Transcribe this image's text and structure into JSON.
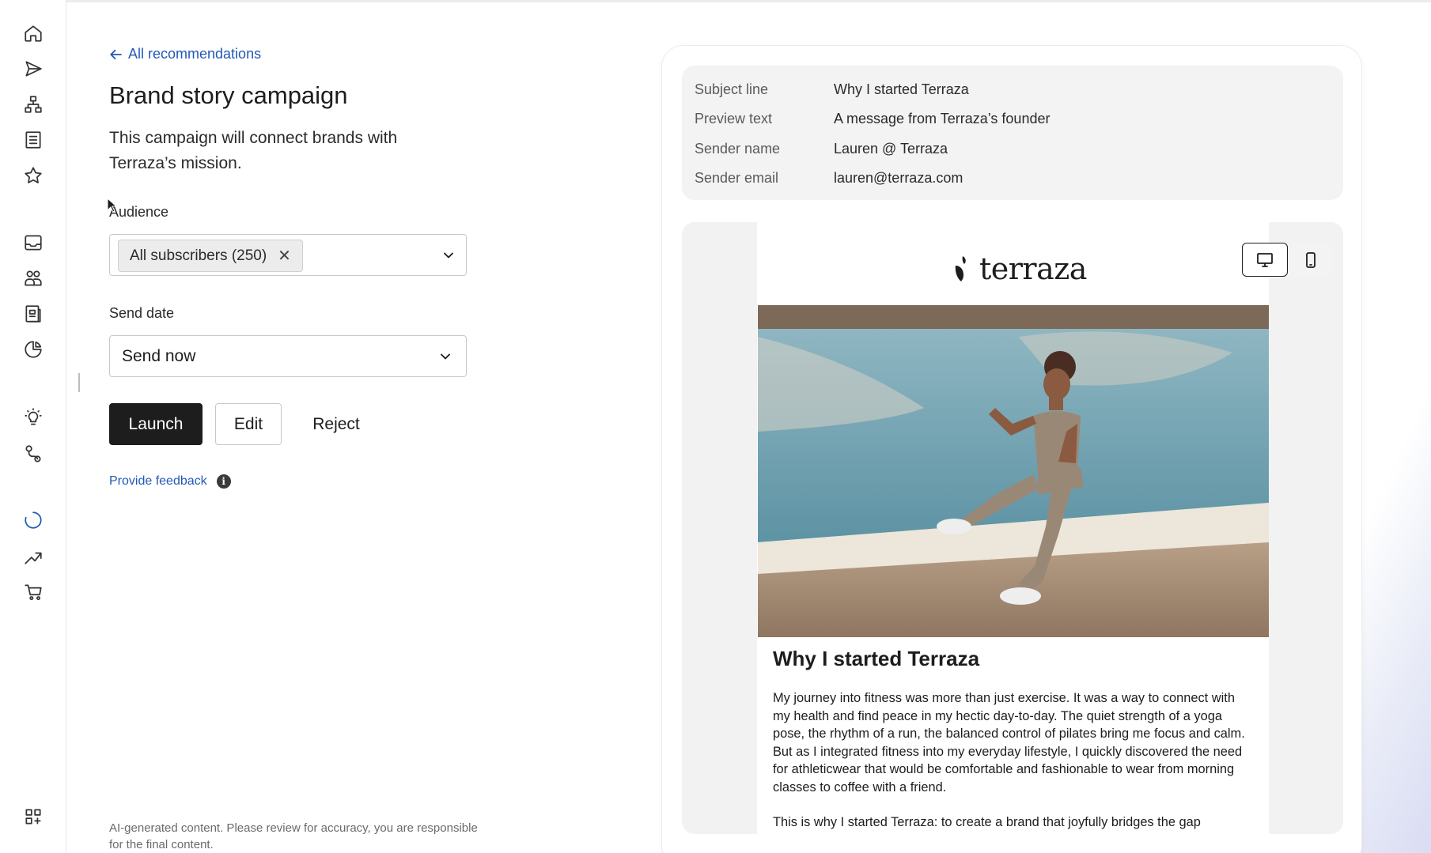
{
  "sidebar": {
    "icons": [
      {
        "name": "home-icon"
      },
      {
        "name": "send-icon"
      },
      {
        "name": "flows-icon"
      },
      {
        "name": "list-icon"
      },
      {
        "name": "star-icon"
      },
      {
        "name": "inbox-icon"
      },
      {
        "name": "audience-icon"
      },
      {
        "name": "content-icon"
      },
      {
        "name": "analytics-icon"
      },
      {
        "name": "lightbulb-icon"
      },
      {
        "name": "integrations-icon"
      },
      {
        "name": "loading-icon"
      },
      {
        "name": "trend-icon"
      },
      {
        "name": "cart-icon"
      },
      {
        "name": "apps-icon"
      }
    ]
  },
  "main": {
    "back_link": "All recommendations",
    "title": "Brand story campaign",
    "description": "This campaign will connect brands with Terraza’s mission.",
    "audience": {
      "label": "Audience",
      "chip": "All subscribers (250)"
    },
    "send_date": {
      "label": "Send date",
      "value": "Send now"
    },
    "buttons": {
      "launch": "Launch",
      "edit": "Edit",
      "reject": "Reject"
    },
    "feedback_link": "Provide feedback",
    "disclaimer": "AI-generated content. Please review for accuracy, you are responsible for the final content."
  },
  "preview": {
    "meta": [
      {
        "key": "Subject line",
        "value": "Why I started Terraza"
      },
      {
        "key": "Preview text",
        "value": "A message from Terraza’s founder"
      },
      {
        "key": "Sender name",
        "value": "Lauren @ Terraza"
      },
      {
        "key": "Sender email",
        "value": "lauren@terraza.com"
      }
    ],
    "logo_text": "terraza",
    "email_heading": "Why I started Terraza",
    "email_body": "My journey into fitness was more than just exercise. It was a way to connect with my health and find peace in my hectic day-to-day. The quiet strength of a yoga pose, the rhythm of a run, the balanced control of pilates bring me focus and calm. But as I integrated fitness into my everyday lifestyle, I quickly discovered the need for athleticwear that would be comfortable and fashionable to wear from morning classes to coffee with a friend.",
    "email_body_2": "This is why I started Terraza: to create a brand that joyfully bridges the gap",
    "device_toggle": {
      "active": "desktop"
    }
  }
}
